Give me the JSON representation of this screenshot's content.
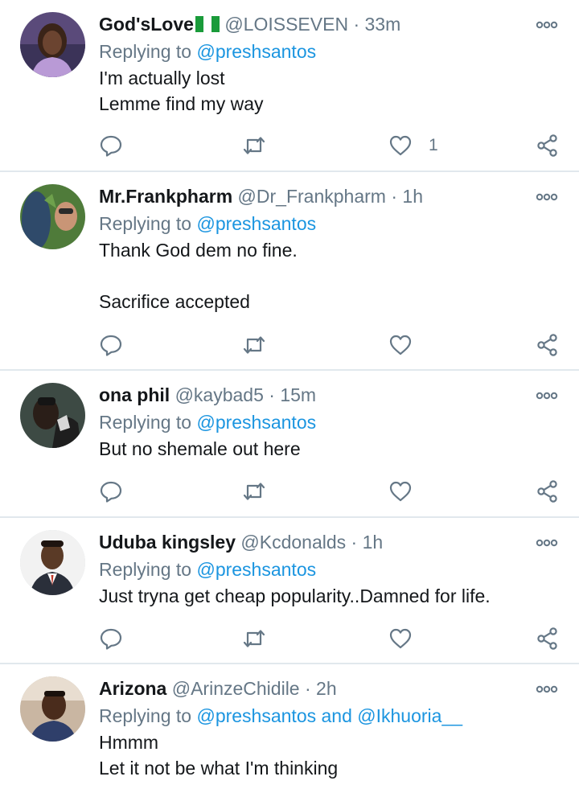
{
  "tweets": [
    {
      "name": "God'sLove",
      "flag": "nigeria-flag",
      "handle": "@LOISSEVEN",
      "time": "33m",
      "replying_prefix": "Replying to ",
      "mentions": "@preshsantos",
      "text": [
        "I'm actually lost",
        "Lemme find my way"
      ],
      "like_count": "1"
    },
    {
      "name": "Mr.Frankpharm",
      "handle": "@Dr_Frankpharm",
      "time": "1h",
      "replying_prefix": "Replying to ",
      "mentions": "@preshsantos",
      "text": [
        "Thank God dem no fine.",
        "",
        "Sacrifice accepted"
      ],
      "like_count": ""
    },
    {
      "name": "ona phil",
      "handle": "@kaybad5",
      "time": "15m",
      "replying_prefix": "Replying to ",
      "mentions": "@preshsantos",
      "text": [
        "But no shemale out here"
      ],
      "like_count": ""
    },
    {
      "name": "Uduba kingsley",
      "handle": "@Kcdonalds",
      "time": "1h",
      "replying_prefix": "Replying to ",
      "mentions": "@preshsantos",
      "text": [
        "Just tryna get cheap popularity..Damned for life."
      ],
      "like_count": ""
    },
    {
      "name": "Arizona",
      "handle": "@ArinzeChidile",
      "time": "2h",
      "replying_prefix": "Replying to ",
      "mentions": "@preshsantos and @Ikhuoria__",
      "text": [
        "Hmmm",
        "Let it not be what I'm thinking"
      ],
      "like_count": ""
    }
  ],
  "dot": "·",
  "icons": {
    "more": "more-options-icon",
    "reply": "reply-icon",
    "retweet": "retweet-icon",
    "like": "like-icon",
    "share": "share-icon"
  },
  "colors": {
    "link": "#1b95e0",
    "muted": "#657786",
    "text": "#14171a",
    "divider": "#e1e8ed"
  }
}
